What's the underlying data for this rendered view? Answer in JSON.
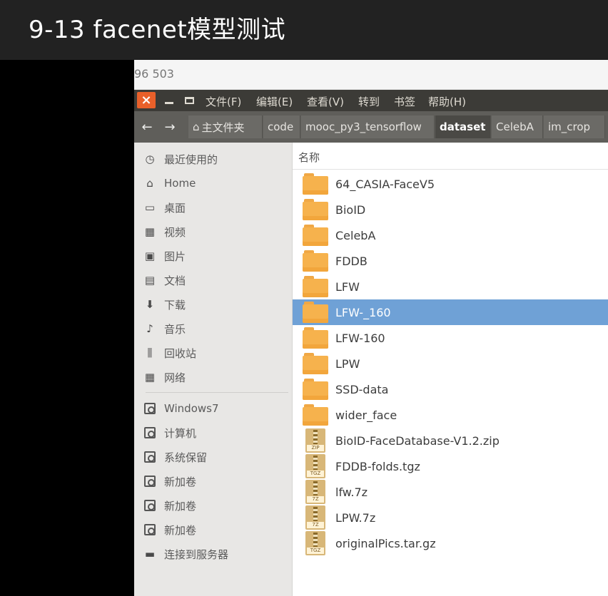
{
  "video": {
    "title": "9-13 facenet模型测试"
  },
  "topbar": {
    "text": "96 503"
  },
  "menubar": {
    "items": [
      "文件(F)",
      "编辑(E)",
      "查看(V)",
      "转到",
      "书签",
      "帮助(H)"
    ]
  },
  "pathbar": {
    "crumbs": [
      "主文件夹",
      "code",
      "mooc_py3_tensorflow",
      "dataset",
      "CelebA",
      "im_crop"
    ],
    "active": "dataset"
  },
  "sidebar": {
    "places": [
      {
        "label": "最近使用的",
        "icon": "clock-icon"
      },
      {
        "label": "Home",
        "icon": "home-icon"
      },
      {
        "label": "桌面",
        "icon": "desktop-icon"
      },
      {
        "label": "视频",
        "icon": "film-icon"
      },
      {
        "label": "图片",
        "icon": "pictures-icon"
      },
      {
        "label": "文档",
        "icon": "document-icon"
      },
      {
        "label": "下载",
        "icon": "download-icon"
      },
      {
        "label": "音乐",
        "icon": "music-icon"
      },
      {
        "label": "回收站",
        "icon": "trash-icon"
      },
      {
        "label": "网络",
        "icon": "network-icon"
      }
    ],
    "devices": [
      {
        "label": "Windows7",
        "icon": "drive-icon"
      },
      {
        "label": "计算机",
        "icon": "drive-icon"
      },
      {
        "label": "系统保留",
        "icon": "drive-icon"
      },
      {
        "label": "新加卷",
        "icon": "drive-icon"
      },
      {
        "label": "新加卷",
        "icon": "drive-icon"
      },
      {
        "label": "新加卷",
        "icon": "drive-icon"
      },
      {
        "label": "连接到服务器",
        "icon": "server-icon"
      }
    ]
  },
  "content": {
    "column_header": "名称",
    "files": [
      {
        "name": "64_CASIA-FaceV5",
        "type": "folder"
      },
      {
        "name": "BioID",
        "type": "folder"
      },
      {
        "name": "CelebA",
        "type": "folder"
      },
      {
        "name": "FDDB",
        "type": "folder"
      },
      {
        "name": "LFW",
        "type": "folder"
      },
      {
        "name": "LFW-_160",
        "type": "folder",
        "selected": true
      },
      {
        "name": "LFW-160",
        "type": "folder"
      },
      {
        "name": "LPW",
        "type": "folder"
      },
      {
        "name": "SSD-data",
        "type": "folder"
      },
      {
        "name": "wider_face",
        "type": "folder"
      },
      {
        "name": "BioID-FaceDatabase-V1.2.zip",
        "type": "archive",
        "ext": "ZIP"
      },
      {
        "name": "FDDB-folds.tgz",
        "type": "archive",
        "ext": "TGZ"
      },
      {
        "name": "lfw.7z",
        "type": "archive",
        "ext": "7Z"
      },
      {
        "name": "LPW.7z",
        "type": "archive",
        "ext": "7Z"
      },
      {
        "name": "originalPics.tar.gz",
        "type": "archive",
        "ext": "TGZ"
      }
    ]
  },
  "colors": {
    "menubar": "#3c3b37",
    "pathbar": "#5f5e5a",
    "selection": "#6fa1d6",
    "folder": "#f6b24d",
    "close_button": "#e9602a"
  }
}
